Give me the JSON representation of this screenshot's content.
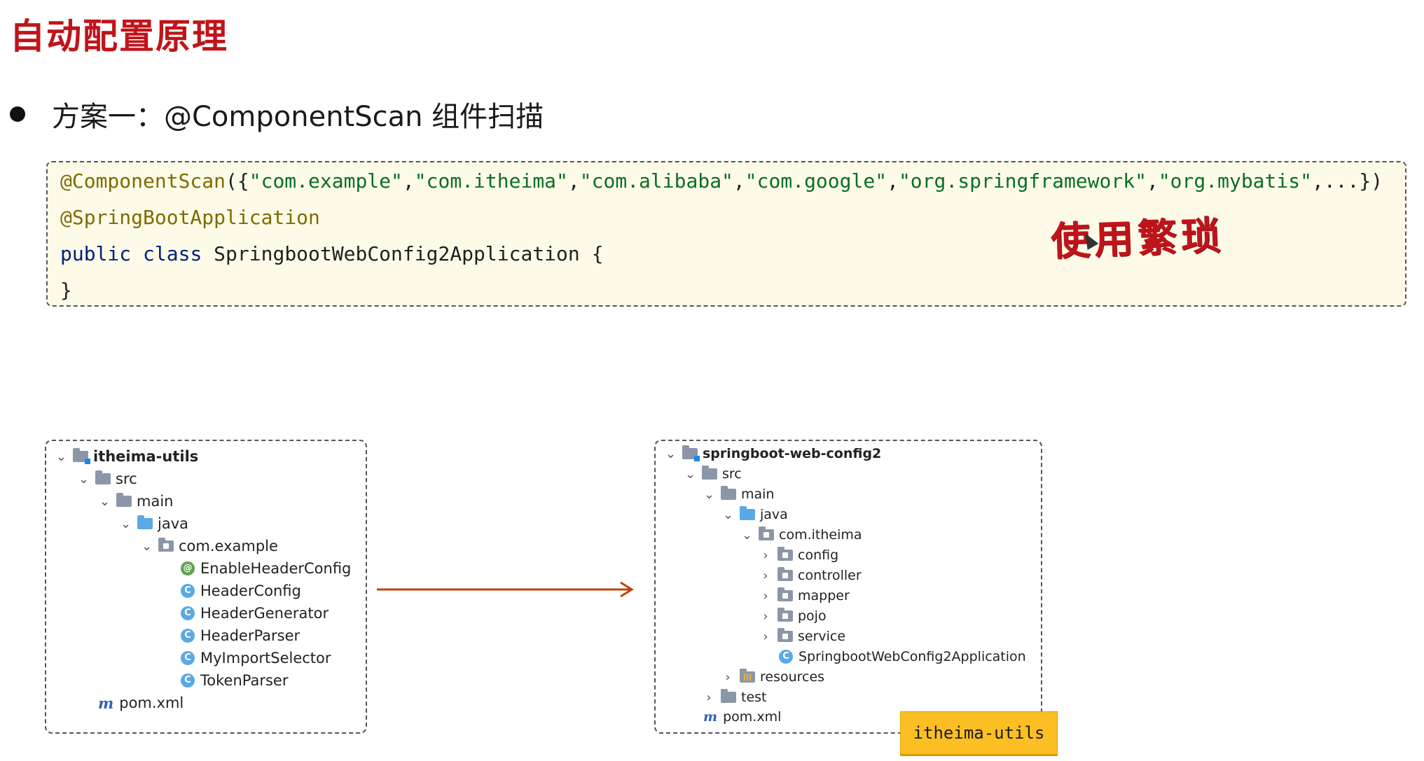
{
  "title": "自动配置原理",
  "bullet": "方案一：@ComponentScan 组件扫描",
  "code": {
    "annotation_scan": "@ComponentScan",
    "scan_open": "({",
    "packages": [
      "\"com.example\"",
      "\"com.itheima\"",
      "\"com.alibaba\"",
      "\"com.google\"",
      "\"org.springframework\"",
      "\"org.mybatis\""
    ],
    "separator": ",",
    "scan_tail": ",...})",
    "annotation_app": "@SpringBootApplication",
    "kw_public": "public",
    "kw_class": "class",
    "class_decl": "SpringbootWebConfig2Application {",
    "closing_brace": "}"
  },
  "handwritten_note": "使用繁琐",
  "left_tree": {
    "root": "itheima-utils",
    "src": "src",
    "main": "main",
    "java": "java",
    "package": "com.example",
    "classes": [
      "EnableHeaderConfig",
      "HeaderConfig",
      "HeaderGenerator",
      "HeaderParser",
      "MyImportSelector",
      "TokenParser"
    ],
    "pom": "pom.xml"
  },
  "right_tree": {
    "root": "springboot-web-config2",
    "src": "src",
    "main": "main",
    "java": "java",
    "package": "com.itheima",
    "subpackages": [
      "config",
      "controller",
      "mapper",
      "pojo",
      "service"
    ],
    "app_class": "SpringbootWebConfig2Application",
    "resources": "resources",
    "test": "test",
    "pom": "pom.xml"
  },
  "badge": "itheima-utils",
  "colors": {
    "title": "#c0141a",
    "code_bg": "#fdfbe8",
    "arrow": "#c2410c",
    "badge": "#fbbf24"
  },
  "icons": {
    "class": "C",
    "annotation": "@",
    "maven": "m"
  }
}
